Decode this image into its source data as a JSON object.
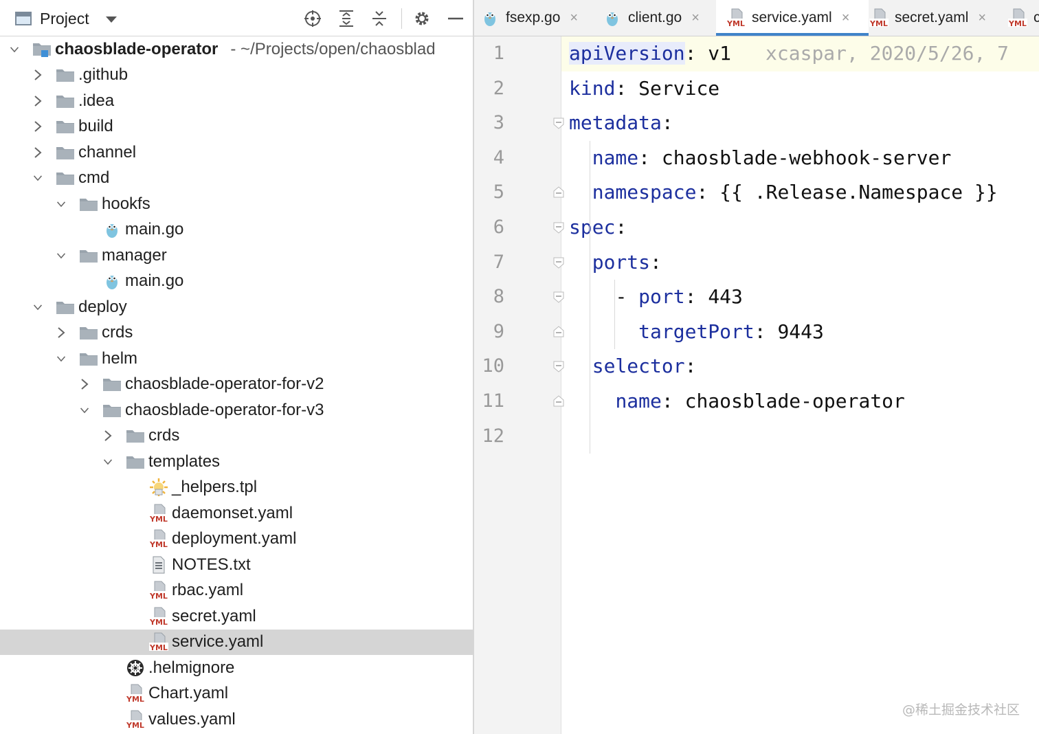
{
  "project_panel": {
    "title": "Project",
    "toolbar_icons": [
      "crosshair-icon",
      "expand-all-icon",
      "collapse-all-icon",
      "gear-icon",
      "minimize-icon"
    ],
    "root": {
      "label": "chaosblade-operator",
      "path": "- ~/Projects/open/chaosblad"
    },
    "tree": [
      {
        "label": "chaosblade-operator",
        "depth": 0,
        "state": "open",
        "icon": "module-folder-icon",
        "root": true
      },
      {
        "label": ".github",
        "depth": 1,
        "state": "closed",
        "icon": "folder-icon"
      },
      {
        "label": ".idea",
        "depth": 1,
        "state": "closed",
        "icon": "folder-icon"
      },
      {
        "label": "build",
        "depth": 1,
        "state": "closed",
        "icon": "folder-icon"
      },
      {
        "label": "channel",
        "depth": 1,
        "state": "closed",
        "icon": "folder-icon"
      },
      {
        "label": "cmd",
        "depth": 1,
        "state": "open",
        "icon": "folder-icon"
      },
      {
        "label": "hookfs",
        "depth": 2,
        "state": "open",
        "icon": "folder-icon"
      },
      {
        "label": "main.go",
        "depth": 3,
        "state": "leaf",
        "icon": "gopher-icon"
      },
      {
        "label": "manager",
        "depth": 2,
        "state": "open",
        "icon": "folder-icon"
      },
      {
        "label": "main.go",
        "depth": 3,
        "state": "leaf",
        "icon": "gopher-icon"
      },
      {
        "label": "deploy",
        "depth": 1,
        "state": "open",
        "icon": "folder-icon"
      },
      {
        "label": "crds",
        "depth": 2,
        "state": "closed",
        "icon": "folder-icon"
      },
      {
        "label": "helm",
        "depth": 2,
        "state": "open",
        "icon": "folder-icon"
      },
      {
        "label": "chaosblade-operator-for-v2",
        "depth": 3,
        "state": "closed",
        "icon": "folder-icon"
      },
      {
        "label": "chaosblade-operator-for-v3",
        "depth": 3,
        "state": "open",
        "icon": "folder-icon"
      },
      {
        "label": "crds",
        "depth": 4,
        "state": "closed",
        "icon": "folder-icon"
      },
      {
        "label": "templates",
        "depth": 4,
        "state": "open",
        "icon": "folder-icon"
      },
      {
        "label": "_helpers.tpl",
        "depth": 5,
        "state": "leaf",
        "icon": "template-icon"
      },
      {
        "label": "daemonset.yaml",
        "depth": 5,
        "state": "leaf",
        "icon": "yaml-file-icon"
      },
      {
        "label": "deployment.yaml",
        "depth": 5,
        "state": "leaf",
        "icon": "yaml-file-icon"
      },
      {
        "label": "NOTES.txt",
        "depth": 5,
        "state": "leaf",
        "icon": "text-file-icon"
      },
      {
        "label": "rbac.yaml",
        "depth": 5,
        "state": "leaf",
        "icon": "yaml-file-icon"
      },
      {
        "label": "secret.yaml",
        "depth": 5,
        "state": "leaf",
        "icon": "yaml-file-icon"
      },
      {
        "label": "service.yaml",
        "depth": 5,
        "state": "leaf",
        "icon": "yaml-file-icon",
        "selected": true
      },
      {
        "label": ".helmignore",
        "depth": 4,
        "state": "leaf",
        "icon": "helm-icon"
      },
      {
        "label": "Chart.yaml",
        "depth": 4,
        "state": "leaf",
        "icon": "yaml-file-icon"
      },
      {
        "label": "values.yaml",
        "depth": 4,
        "state": "leaf",
        "icon": "yaml-file-icon"
      }
    ]
  },
  "editor": {
    "tabs": [
      {
        "label": "fsexp.go",
        "icon": "gopher-icon",
        "active": false
      },
      {
        "label": "client.go",
        "icon": "gopher-icon",
        "active": false
      },
      {
        "label": "service.yaml",
        "icon": "yaml-file-icon",
        "active": true
      },
      {
        "label": "secret.yaml",
        "icon": "yaml-file-icon",
        "active": false
      },
      {
        "label": "c",
        "icon": "yaml-file-icon",
        "active": false
      }
    ],
    "close_glyph": "×",
    "yml_badge": "YML",
    "blame": "xcaspar, 2020/5/26, 7",
    "lines": [
      {
        "n": "1",
        "indent": 0,
        "key": "apiVersion",
        "value": "v1"
      },
      {
        "n": "2",
        "indent": 0,
        "key": "kind",
        "value": "Service"
      },
      {
        "n": "3",
        "indent": 0,
        "key": "metadata",
        "value": ""
      },
      {
        "n": "4",
        "indent": 1,
        "key": "name",
        "value": "chaosblade-webhook-server"
      },
      {
        "n": "5",
        "indent": 1,
        "key": "namespace",
        "value": "{{ .Release.Namespace }}"
      },
      {
        "n": "6",
        "indent": 0,
        "key": "spec",
        "value": ""
      },
      {
        "n": "7",
        "indent": 1,
        "key": "ports",
        "value": ""
      },
      {
        "n": "8",
        "indent": 2,
        "key": "port",
        "value": "443",
        "dash": true
      },
      {
        "n": "9",
        "indent": 3,
        "key": "targetPort",
        "value": "9443"
      },
      {
        "n": "10",
        "indent": 1,
        "key": "selector",
        "value": ""
      },
      {
        "n": "11",
        "indent": 2,
        "key": "name",
        "value": "chaosblade-operator"
      },
      {
        "n": "12",
        "indent": 0,
        "key": "",
        "value": ""
      }
    ]
  },
  "watermark": "@稀土掘金技术社区",
  "colors": {
    "yaml_key": "#1c2f9e",
    "selection": "#d5d5d5",
    "accent": "#4083c9",
    "gutter": "#f3f3f3"
  }
}
